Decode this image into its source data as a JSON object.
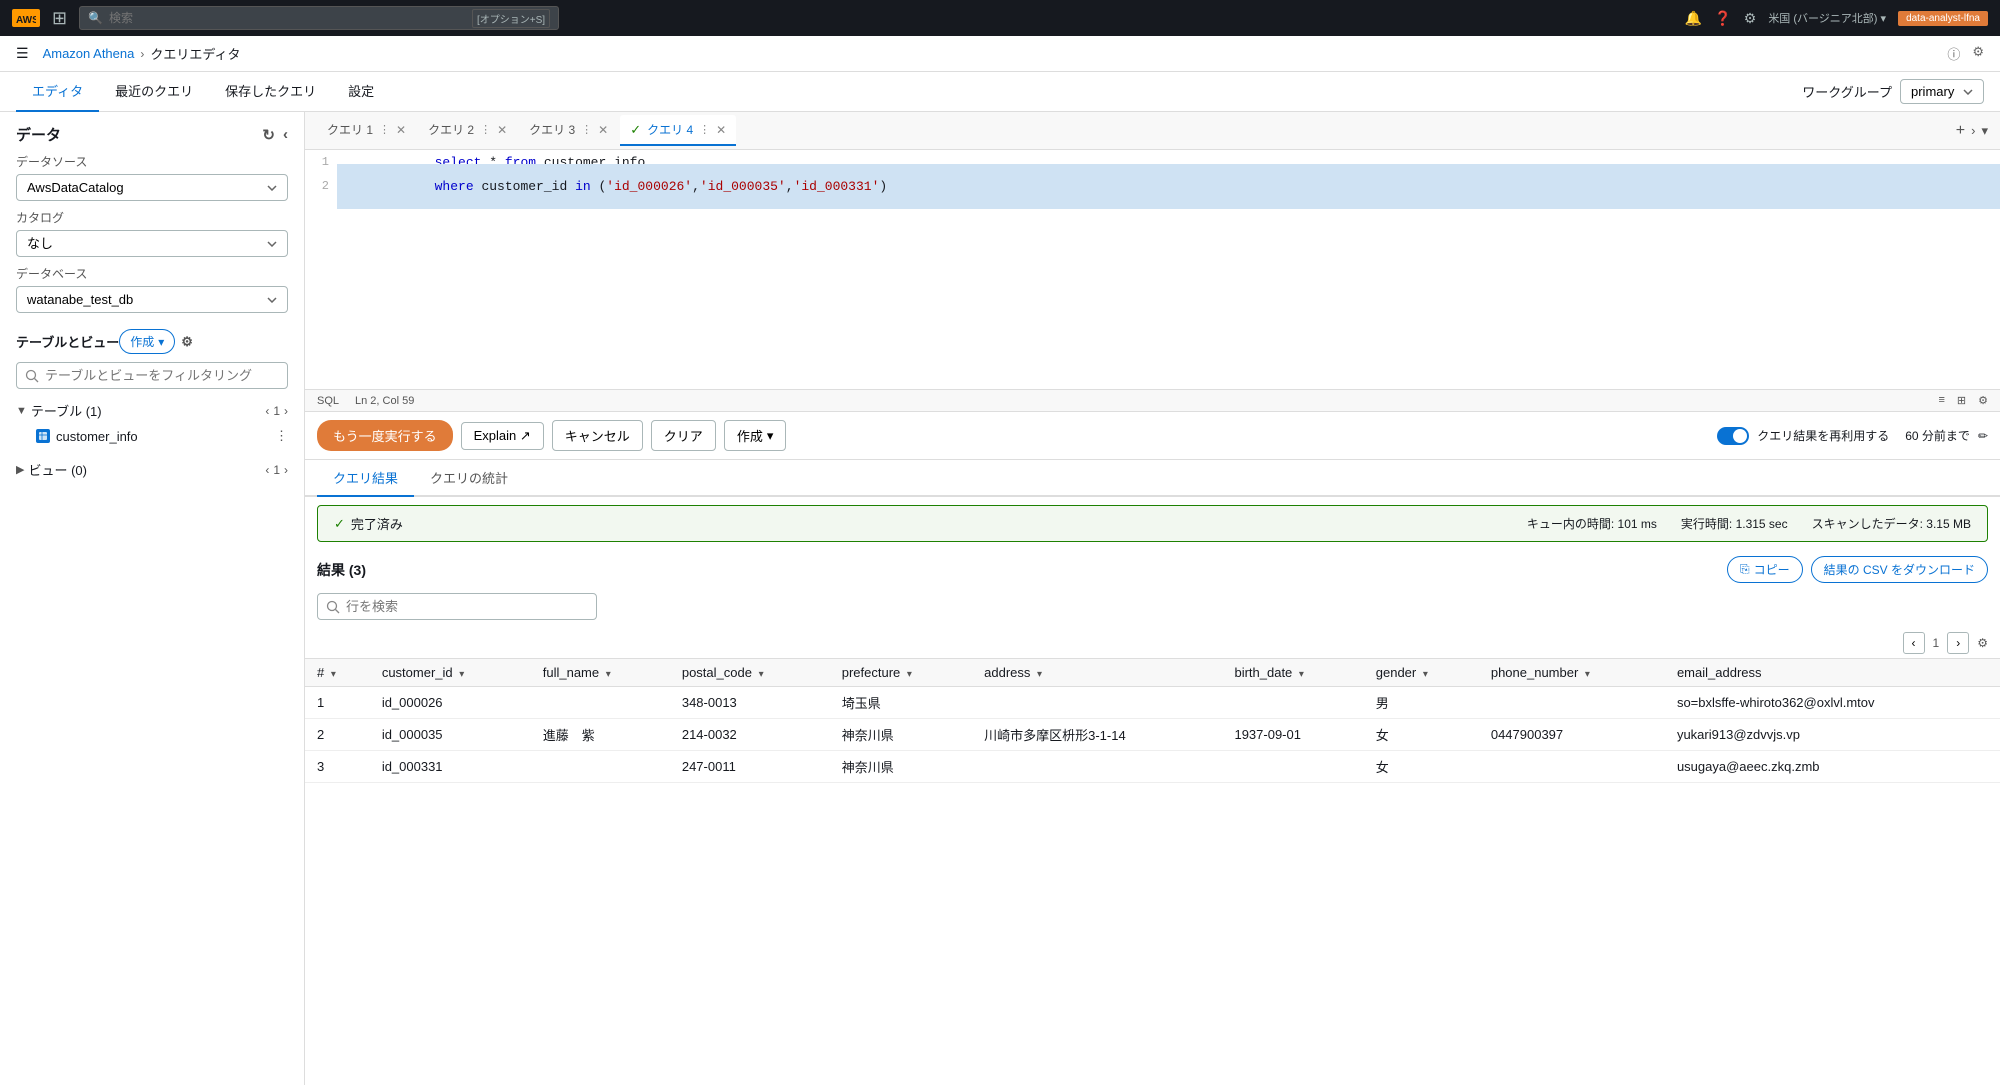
{
  "topnav": {
    "aws_label": "AWS",
    "search_placeholder": "検索",
    "search_hint": "[オプション+S]",
    "region": "米国 (バージニア北部) ▾",
    "user": "data-analyst-lfna"
  },
  "breadcrumb": {
    "service": "Amazon Athena",
    "current": "クエリエディタ"
  },
  "tabs": {
    "items": [
      "エディタ",
      "最近のクエリ",
      "保存したクエリ",
      "設定"
    ],
    "active": 0,
    "workgroup_label": "ワークグループ",
    "workgroup_value": "primary"
  },
  "sidebar": {
    "title": "データ",
    "datasource_label": "データソース",
    "datasource_value": "AwsDataCatalog",
    "catalog_label": "カタログ",
    "catalog_value": "なし",
    "database_label": "データベース",
    "database_value": "watanabe_test_db",
    "tables_label": "テーブルとビュー",
    "create_btn": "作成",
    "filter_placeholder": "テーブルとビューをフィルタリング",
    "tables_section": "テーブル (1)",
    "tables_count": "1",
    "table_name": "customer_info",
    "views_section": "ビュー (0)",
    "views_count": "1"
  },
  "editor": {
    "query_tabs": [
      {
        "label": "クエリ 1",
        "active": false,
        "has_check": false
      },
      {
        "label": "クエリ 2",
        "active": false,
        "has_check": false
      },
      {
        "label": "クエリ 3",
        "active": false,
        "has_check": false
      },
      {
        "label": "クエリ 4",
        "active": true,
        "has_check": true
      }
    ],
    "lines": [
      {
        "num": 1,
        "content": "select * from customer_info"
      },
      {
        "num": 2,
        "content": "where customer_id in ('id_000026','id_000035','id_000331')",
        "active": true
      }
    ],
    "status": {
      "lang": "SQL",
      "position": "Ln 2, Col 59"
    }
  },
  "actions": {
    "run_again": "もう一度実行する",
    "explain": "Explain ↗",
    "cancel": "キャンセル",
    "clear": "クリア",
    "create": "作成",
    "reuse_label": "クエリ結果を再利用する",
    "reuse_time": "60 分前まで"
  },
  "results": {
    "tabs": [
      "クエリ結果",
      "クエリの統計"
    ],
    "active_tab": 0,
    "status": "完了済み",
    "queue_time_label": "キュー内の時間:",
    "queue_time": "101 ms",
    "exec_time_label": "実行時間:",
    "exec_time": "1.315 sec",
    "scan_label": "スキャンしたデータ:",
    "scan_size": "3.15 MB",
    "result_label": "結果 (3)",
    "copy_label": "コピー",
    "download_label": "結果の CSV をダウンロード",
    "search_placeholder": "行を検索",
    "page_current": "1",
    "columns": [
      "#",
      "customer_id",
      "full_name",
      "postal_code",
      "prefecture",
      "address",
      "birth_date",
      "gender",
      "phone_number",
      "email_address"
    ],
    "rows": [
      {
        "num": "1",
        "customer_id": "id_000026",
        "full_name": "",
        "postal_code": "348-0013",
        "prefecture": "埼玉県",
        "address": "",
        "birth_date": "",
        "gender": "男",
        "phone_number": "",
        "email_address": "so=bxlsffe-whiroto362@oxlvl.mtov"
      },
      {
        "num": "2",
        "customer_id": "id_000035",
        "full_name": "進藤　紫",
        "postal_code": "214-0032",
        "prefecture": "神奈川県",
        "address": "川崎市多摩区枡形3-1-14",
        "birth_date": "1937-09-01",
        "gender": "女",
        "phone_number": "0447900397",
        "email_address": "yukari913@zdvvjs.vp"
      },
      {
        "num": "3",
        "customer_id": "id_000331",
        "full_name": "",
        "postal_code": "247-0011",
        "prefecture": "神奈川県",
        "address": "",
        "birth_date": "",
        "gender": "女",
        "phone_number": "",
        "email_address": "usugaya@aeec.zkq.zmb"
      }
    ]
  }
}
